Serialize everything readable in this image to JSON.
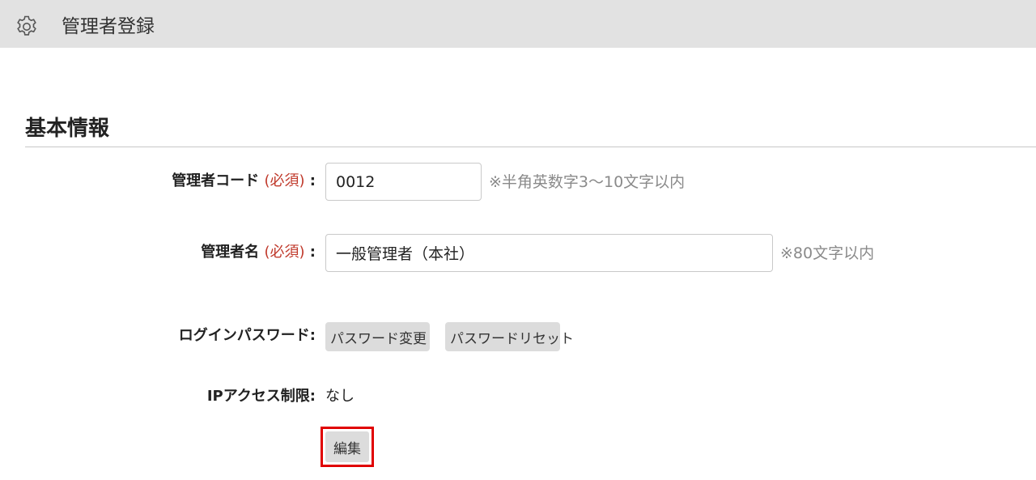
{
  "header": {
    "icon": "gear-icon",
    "title": "管理者登録"
  },
  "section": {
    "title": "基本情報"
  },
  "form": {
    "code": {
      "label": "管理者コード",
      "required": "(必須)",
      "colon": ":",
      "value": "0012",
      "note": "※半角英数字3～10文字以内"
    },
    "name": {
      "label": "管理者名",
      "required": "(必須)",
      "colon": ":",
      "value": "一般管理者（本社）",
      "note": "※80文字以内"
    },
    "password": {
      "label": "ログインパスワード:",
      "change_button": "パスワード変更",
      "reset_button": "パスワードリセット"
    },
    "ip": {
      "label": "IPアクセス制限:",
      "value": "なし"
    },
    "edit_button": "編集"
  },
  "colors": {
    "header_bg": "#e2e2e2",
    "required": "#c0392b",
    "highlight": "#e00000",
    "button_bg": "#dcdcdc"
  }
}
